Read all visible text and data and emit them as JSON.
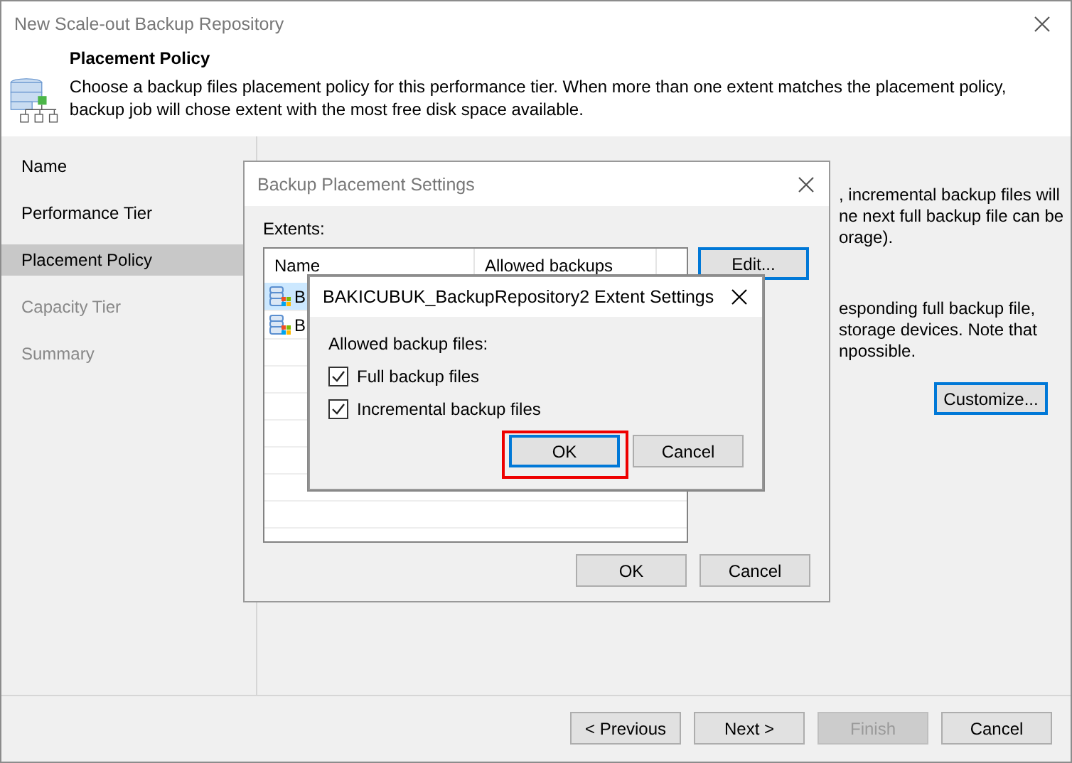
{
  "window": {
    "title": "New Scale-out Backup Repository"
  },
  "header": {
    "title": "Placement Policy",
    "description": "Choose a backup files placement policy for this performance tier. When more than one extent matches the placement policy, backup job will chose extent with the most free disk space available."
  },
  "sidebar": {
    "items": [
      {
        "label": "Name",
        "selected": false,
        "disabled": false
      },
      {
        "label": "Performance Tier",
        "selected": false,
        "disabled": false
      },
      {
        "label": "Placement Policy",
        "selected": true,
        "disabled": false
      },
      {
        "label": "Capacity Tier",
        "selected": false,
        "disabled": true
      },
      {
        "label": "Summary",
        "selected": false,
        "disabled": true
      }
    ]
  },
  "content": {
    "paragraph_1": [
      ", incremental backup files will",
      "ne next full backup file can be",
      "orage)."
    ],
    "paragraph_2": [
      "esponding full backup file,",
      "storage devices. Note that",
      "npossible."
    ],
    "customize_button": "Customize..."
  },
  "placement_dialog": {
    "title": "Backup Placement Settings",
    "extents_label": "Extents:",
    "columns": [
      "Name",
      "Allowed backups"
    ],
    "rows": [
      {
        "name": "B",
        "selected": true
      },
      {
        "name": "B",
        "selected": false
      }
    ],
    "edit_button": "Edit...",
    "ok_button": "OK",
    "cancel_button": "Cancel"
  },
  "extent_dialog": {
    "title": "BAKICUBUK_BackupRepository2 Extent Settings",
    "group_label": "Allowed backup files:",
    "options": [
      {
        "label": "Full backup files",
        "checked": true
      },
      {
        "label": "Incremental backup files",
        "checked": true
      }
    ],
    "ok_button": "OK",
    "cancel_button": "Cancel"
  },
  "footer": {
    "buttons": [
      {
        "label": "< Previous",
        "disabled": false
      },
      {
        "label": "Next >",
        "disabled": false
      },
      {
        "label": "Finish",
        "disabled": true
      },
      {
        "label": "Cancel",
        "disabled": false
      }
    ]
  }
}
